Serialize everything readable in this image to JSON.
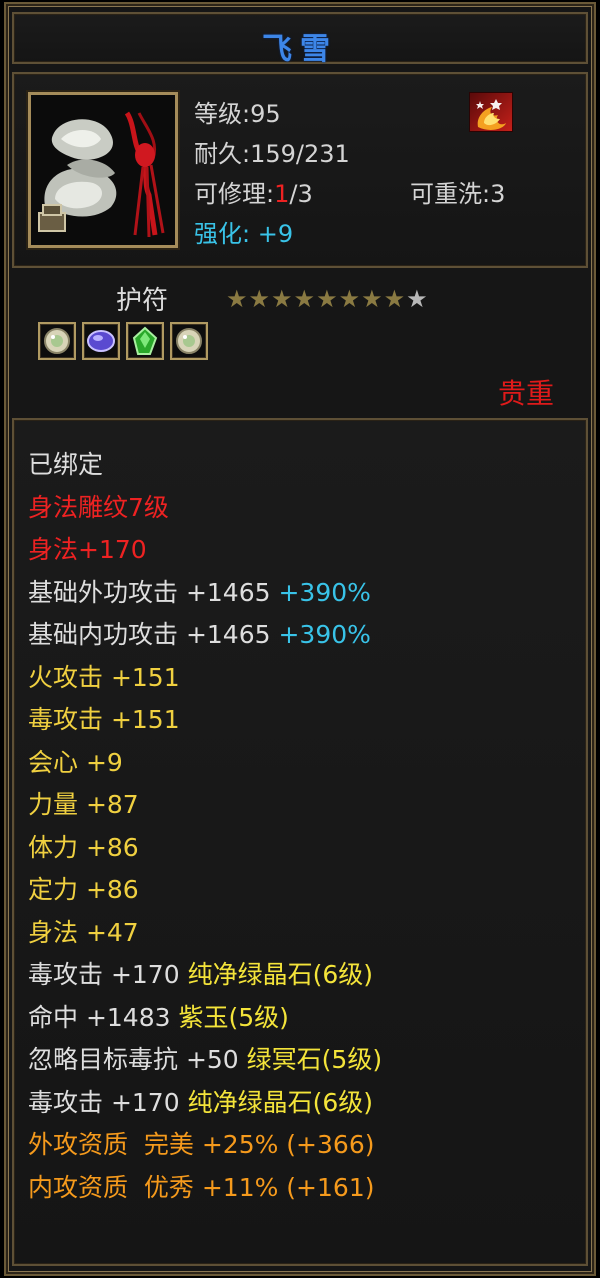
{
  "item": {
    "name": "飞雪",
    "level_label": "等级:",
    "level": "95",
    "durability_label": "耐久:",
    "durability": "159/231",
    "repair_label": "可修理:",
    "repair_used": "1",
    "repair_max": "/3",
    "rewash_label": "可重洗:",
    "rewash": "3",
    "enhance_label": "强化:",
    "enhance": "+9",
    "type": "护符",
    "quality": "贵重",
    "stars": {
      "filled": 8,
      "total": 9
    },
    "gems": [
      "pale-jade-gem-icon",
      "purple-gem-icon",
      "green-crystal-gem-icon",
      "pale-jade-gem-icon"
    ],
    "icon": "jade-amulet-icon",
    "badge_icon": "fire-ornament-icon"
  },
  "attributes": [
    {
      "parts": [
        {
          "text": "已绑定",
          "color": "white"
        }
      ]
    },
    {
      "parts": [
        {
          "text": "身法雕纹7级",
          "color": "red"
        }
      ]
    },
    {
      "parts": [
        {
          "text": "身法+170",
          "color": "red"
        }
      ]
    },
    {
      "parts": [
        {
          "text": "基础外功攻击 +1465 ",
          "color": "white"
        },
        {
          "text": "+390%",
          "color": "cyan"
        }
      ]
    },
    {
      "parts": [
        {
          "text": "基础内功攻击 +1465 ",
          "color": "white"
        },
        {
          "text": "+390%",
          "color": "cyan"
        }
      ]
    },
    {
      "parts": [
        {
          "text": "火攻击 +151",
          "color": "yellow"
        }
      ]
    },
    {
      "parts": [
        {
          "text": "毒攻击 +151",
          "color": "yellow"
        }
      ]
    },
    {
      "parts": [
        {
          "text": "会心 +9",
          "color": "yellow"
        }
      ]
    },
    {
      "parts": [
        {
          "text": "力量 +87",
          "color": "yellow"
        }
      ]
    },
    {
      "parts": [
        {
          "text": "体力 +86",
          "color": "yellow"
        }
      ]
    },
    {
      "parts": [
        {
          "text": "定力 +86",
          "color": "yellow"
        }
      ]
    },
    {
      "parts": [
        {
          "text": "身法 +47",
          "color": "yellow"
        }
      ]
    },
    {
      "parts": [
        {
          "text": "毒攻击 +170 ",
          "color": "white"
        },
        {
          "text": "纯净绿晶石(6级)",
          "color": "bright-yellow"
        }
      ]
    },
    {
      "parts": [
        {
          "text": "命中 +1483 ",
          "color": "white"
        },
        {
          "text": "紫玉(5级)",
          "color": "bright-yellow"
        }
      ]
    },
    {
      "parts": [
        {
          "text": "忽略目标毒抗 +50 ",
          "color": "white"
        },
        {
          "text": "绿冥石(5级)",
          "color": "bright-yellow"
        }
      ]
    },
    {
      "parts": [
        {
          "text": "毒攻击 +170 ",
          "color": "white"
        },
        {
          "text": "纯净绿晶石(6级)",
          "color": "bright-yellow"
        }
      ]
    },
    {
      "parts": [
        {
          "text": "外攻资质  完美 +25% (+366)",
          "color": "orange"
        }
      ]
    },
    {
      "parts": [
        {
          "text": "内攻资质  优秀 +11% (+161)",
          "color": "orange"
        }
      ]
    }
  ],
  "colors": {
    "white": "#dedede",
    "red": "#ee2222",
    "yellow": "#f0d040",
    "cyan": "#39c3e8",
    "orange": "#f59a1c",
    "bright-yellow": "#f4e43a",
    "title": "#3d86e8",
    "star_filled": "#8a7a42",
    "star_empty": "#b8b8b8"
  }
}
